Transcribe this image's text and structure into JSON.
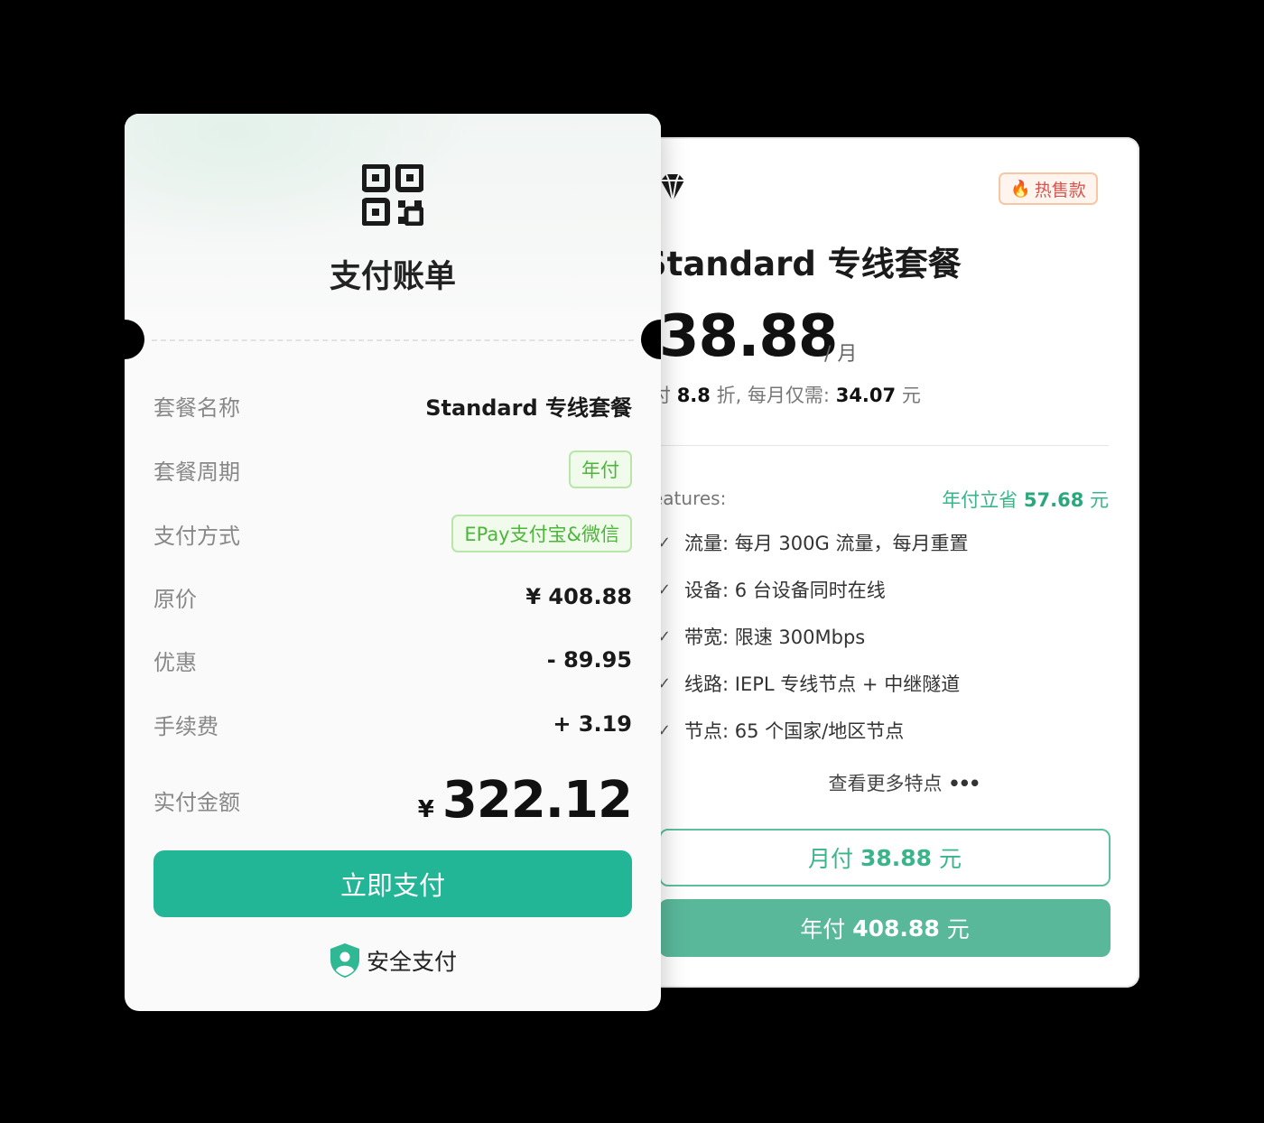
{
  "plan_card": {
    "badge": "热售款",
    "title": "Standard 专线套餐",
    "price": "38.88",
    "price_unit": "/ 月",
    "subtitle_prefix": "付",
    "discount": "8.8",
    "subtitle_mid": "折, 每月仅需:",
    "monthly": "34.07",
    "subtitle_suffix": "元",
    "features_label": "eatures:",
    "save_prefix": "年付立省",
    "save_amount": "57.68",
    "save_suffix": "元",
    "features": [
      "流量: 每月 300G 流量，每月重置",
      "设备: 6 台设备同时在线",
      "带宽: 限速 300Mbps",
      "线路: IEPL 专线节点 + 中继隧道",
      "节点: 65 个国家/地区节点"
    ],
    "more_label": "查看更多特点",
    "more_dots": "•••",
    "month_btn_prefix": "月付",
    "month_btn_amount": "38.88",
    "month_btn_suffix": "元",
    "year_btn_prefix": "年付",
    "year_btn_amount": "408.88",
    "year_btn_suffix": "元"
  },
  "bill_card": {
    "title": "支付账单",
    "rows": [
      {
        "label": "套餐名称",
        "value": "Standard 专线套餐"
      },
      {
        "label": "套餐周期",
        "value": "年付"
      },
      {
        "label": "支付方式",
        "value": "EPay支付宝&微信"
      },
      {
        "label": "原价",
        "value": "¥ 408.88"
      },
      {
        "label": "优惠",
        "value": "- 89.95"
      },
      {
        "label": "手续费",
        "value": "+ 3.19"
      }
    ],
    "total_label": "实付金额",
    "total_currency": "¥",
    "total_value": "322.12",
    "pay_button": "立即支付",
    "secure_label": "安全支付"
  },
  "colors": {
    "accent": "#22b596",
    "accent_light": "#5ab89a",
    "tag_green": "#4cb63a",
    "hot_red": "#d9534f"
  },
  "icons": [
    "diamond-icon",
    "fire-icon",
    "check-icon",
    "qr-code-icon",
    "shield-user-icon"
  ]
}
